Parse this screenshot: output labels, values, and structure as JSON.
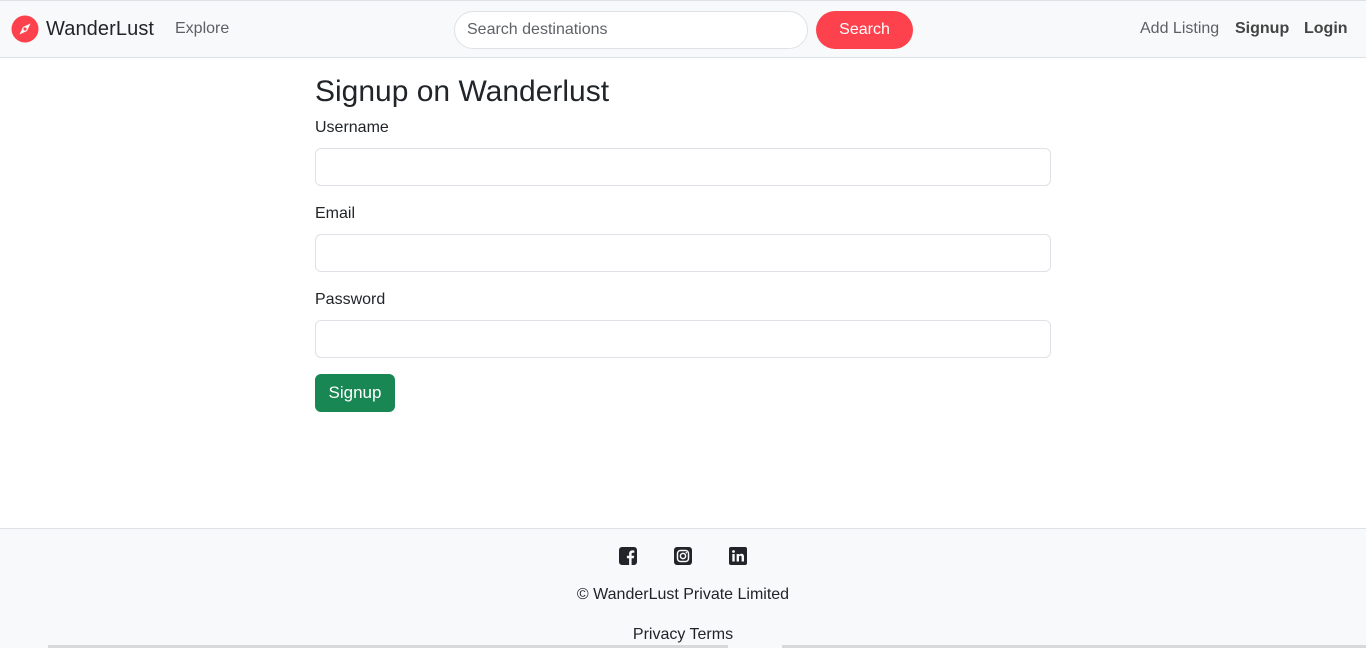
{
  "navbar": {
    "brand": "WanderLust",
    "explore": "Explore",
    "search_placeholder": "Search destinations",
    "search_button": "Search",
    "add_listing": "Add Listing",
    "signup": "Signup",
    "login": "Login",
    "brand_icon": "compass-icon",
    "accent_color": "#fe424d"
  },
  "form": {
    "title": "Signup on Wanderlust",
    "username_label": "Username",
    "username_value": "",
    "email_label": "Email",
    "email_value": "",
    "password_label": "Password",
    "password_value": "",
    "submit_button": "Signup",
    "submit_color": "#198754"
  },
  "footer": {
    "socials": [
      "facebook-icon",
      "instagram-icon",
      "linkedin-icon"
    ],
    "copyright": "© WanderLust Private Limited",
    "privacy": "Privacy",
    "terms": "Terms"
  }
}
